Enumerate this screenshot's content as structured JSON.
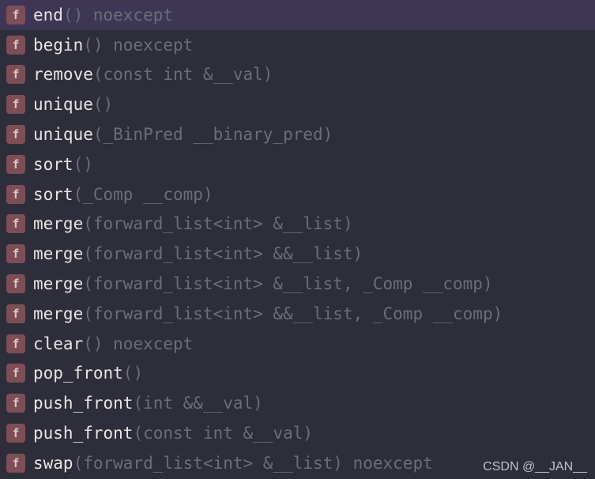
{
  "completions": [
    {
      "icon": "f",
      "name": "end",
      "signature": "() noexcept"
    },
    {
      "icon": "f",
      "name": "begin",
      "signature": "() noexcept"
    },
    {
      "icon": "f",
      "name": "remove",
      "signature": "(const int &__val)"
    },
    {
      "icon": "f",
      "name": "unique",
      "signature": "()"
    },
    {
      "icon": "f",
      "name": "unique",
      "signature": "(_BinPred __binary_pred)"
    },
    {
      "icon": "f",
      "name": "sort",
      "signature": "()"
    },
    {
      "icon": "f",
      "name": "sort",
      "signature": "(_Comp __comp)"
    },
    {
      "icon": "f",
      "name": "merge",
      "signature": "(forward_list<int> &__list)"
    },
    {
      "icon": "f",
      "name": "merge",
      "signature": "(forward_list<int> &&__list)"
    },
    {
      "icon": "f",
      "name": "merge",
      "signature": "(forward_list<int> &__list, _Comp __comp)"
    },
    {
      "icon": "f",
      "name": "merge",
      "signature": "(forward_list<int> &&__list, _Comp __comp)"
    },
    {
      "icon": "f",
      "name": "clear",
      "signature": "() noexcept"
    },
    {
      "icon": "f",
      "name": "pop_front",
      "signature": "()"
    },
    {
      "icon": "f",
      "name": "push_front",
      "signature": "(int &&__val)"
    },
    {
      "icon": "f",
      "name": "push_front",
      "signature": "(const int &__val)"
    },
    {
      "icon": "f",
      "name": "swap",
      "signature": "(forward_list<int> &__list) noexcept"
    }
  ],
  "selectedIndex": 0,
  "watermark": "CSDN @__JAN__"
}
